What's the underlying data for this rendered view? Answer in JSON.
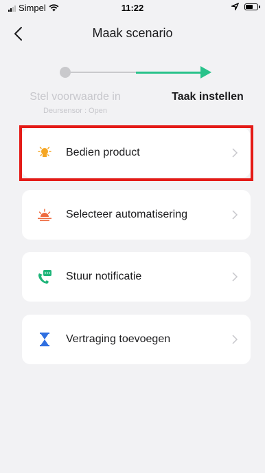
{
  "status_bar": {
    "carrier": "Simpel",
    "time": "11:22"
  },
  "header": {
    "title": "Maak scenario",
    "back_icon": "chevron-left-icon"
  },
  "steps": {
    "step1_label": "Stel voorwaarde in",
    "step1_sub": "Deursensor : Open",
    "step2_label": "Taak instellen",
    "active_color": "#28c28a",
    "inactive_color": "#c9c9cc"
  },
  "actions": [
    {
      "label": "Bedien product",
      "icon": "bulb-icon",
      "color": "#f5a623"
    },
    {
      "label": "Selecteer automatisering",
      "icon": "sunrise-icon",
      "color": "#ee6a3f"
    },
    {
      "label": "Stuur notificatie",
      "icon": "phone-message-icon",
      "color": "#1fb57a"
    },
    {
      "label": "Vertraging toevoegen",
      "icon": "hourglass-icon",
      "color": "#2f6fe0"
    }
  ],
  "highlight_color": "#e41b17"
}
